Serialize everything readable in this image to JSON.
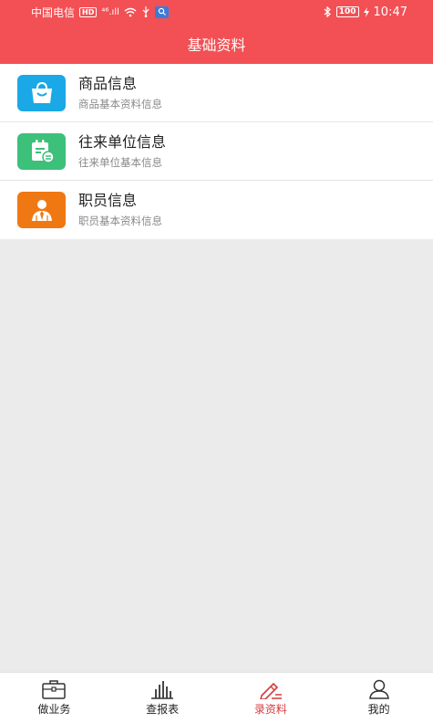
{
  "status_bar": {
    "carrier": "中国电信",
    "hd_badge": "HD",
    "signal": "⁴⁶.ıll",
    "battery": "100",
    "time": "10:47"
  },
  "header": {
    "title": "基础资料"
  },
  "items": [
    {
      "title": "商品信息",
      "subtitle": "商品基本资料信息",
      "color": "#1aa8e6"
    },
    {
      "title": "往来单位信息",
      "subtitle": "往来单位基本信息",
      "color": "#3cc07a"
    },
    {
      "title": "职员信息",
      "subtitle": "职员基本资料信息",
      "color": "#f07813"
    }
  ],
  "tabs": [
    {
      "label": "做业务",
      "icon": "briefcase-icon"
    },
    {
      "label": "查报表",
      "icon": "bar-chart-icon"
    },
    {
      "label": "录资料",
      "icon": "edit-pen-icon",
      "active": true
    },
    {
      "label": "我的",
      "icon": "user-icon"
    }
  ],
  "colors": {
    "brand": "#f25054",
    "active_tab": "#d43c3c",
    "background": "#ebebeb"
  }
}
